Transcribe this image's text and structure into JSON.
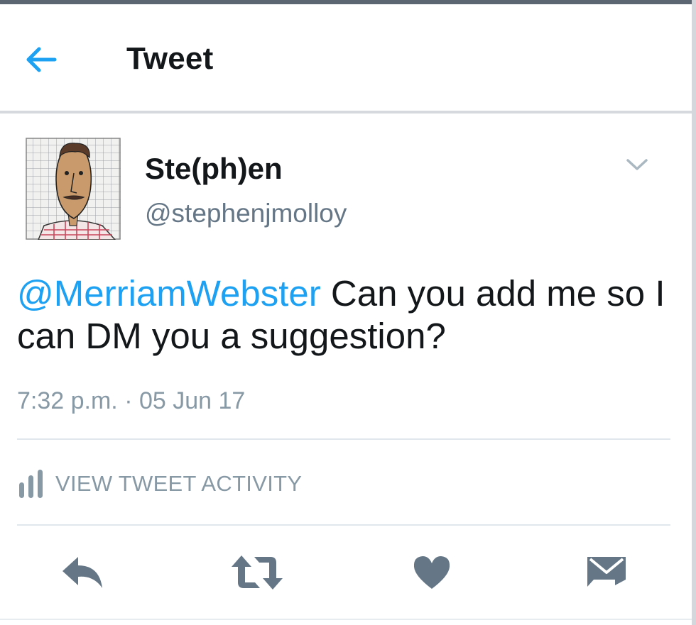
{
  "header": {
    "title": "Tweet",
    "back_icon": "arrow-left-icon"
  },
  "author": {
    "display_name": "Ste(ph)en",
    "handle": "@stephenjmolloy",
    "menu_icon": "chevron-down-icon"
  },
  "tweet": {
    "mention": "@MerriamWebster",
    "body": " Can you add me so I can DM you a suggestion?",
    "timestamp": "7:32 p.m. · 05 Jun 17"
  },
  "activity": {
    "label": "VIEW TWEET ACTIVITY",
    "icon": "bar-chart-icon"
  },
  "actions": [
    {
      "name": "reply",
      "icon": "reply-icon"
    },
    {
      "name": "retweet",
      "icon": "retweet-icon"
    },
    {
      "name": "like",
      "icon": "heart-icon"
    },
    {
      "name": "direct-message",
      "icon": "envelope-icon"
    }
  ],
  "colors": {
    "accent": "#1da1f2",
    "text": "#14171a",
    "secondary": "#657786",
    "muted": "#8899a6",
    "icon_gray": "#657786",
    "divider": "#e1e8ed"
  }
}
